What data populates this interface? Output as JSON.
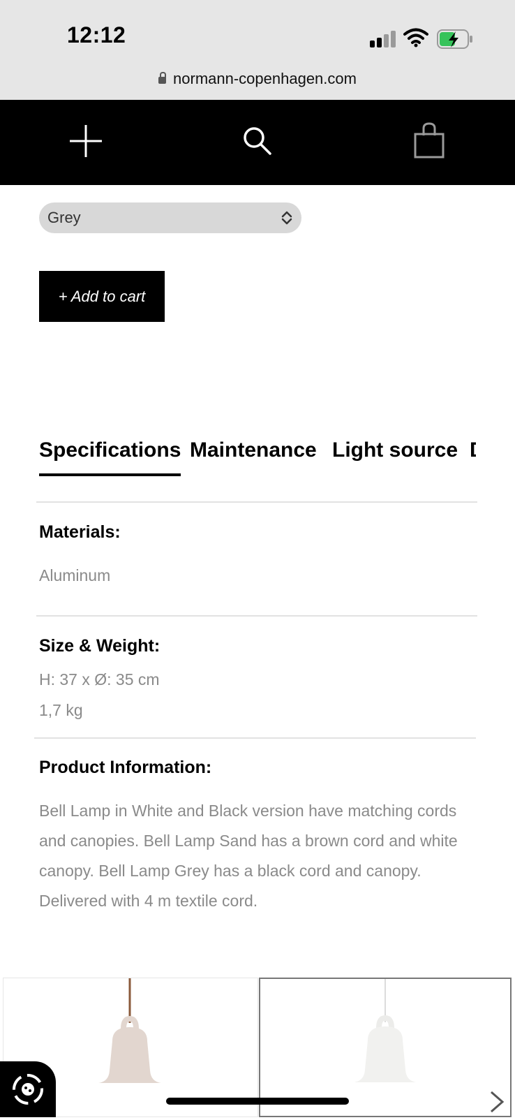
{
  "status_bar": {
    "time": "12:12",
    "url": "normann-copenhagen.com"
  },
  "nav": {
    "menu_icon": "plus-cross-icon",
    "search_icon": "search-icon",
    "cart_icon": "shopping-bag-icon"
  },
  "product": {
    "color_select": {
      "selected": "Grey",
      "icon": "chevron-up-down-icon"
    },
    "add_to_cart_label": "+ Add to cart"
  },
  "tabs": [
    {
      "label": "Specifications",
      "active": true
    },
    {
      "label": "Maintenance",
      "active": false
    },
    {
      "label": "Light source",
      "active": false
    },
    {
      "label": "D",
      "active": false
    }
  ],
  "specs": {
    "materials_heading": "Materials:",
    "materials_value": "Aluminum",
    "size_heading": "Size & Weight:",
    "size_value": "H: 37 x Ø: 35 cm",
    "weight_value": "1,7 kg",
    "info_heading": "Product Information:",
    "info_text": "Bell Lamp in White and Black version have matching cords and canopies. Bell Lamp Sand has a brown cord and white canopy. Bell Lamp Grey has a black cord and canopy. Delivered with 4 m textile cord."
  },
  "thumbnails": [
    {
      "name": "bell-lamp-sand",
      "color": "#e2d6cf",
      "cord": "#8a5a3b",
      "selected": false
    },
    {
      "name": "bell-lamp-white",
      "color": "#f4f4f2",
      "cord": "#dcdcdc",
      "selected": true
    }
  ],
  "colors": {
    "nav_bg": "#000000",
    "status_bg": "#e6e6e6",
    "muted_text": "#8a8a8a",
    "battery_green": "#36c35a"
  }
}
